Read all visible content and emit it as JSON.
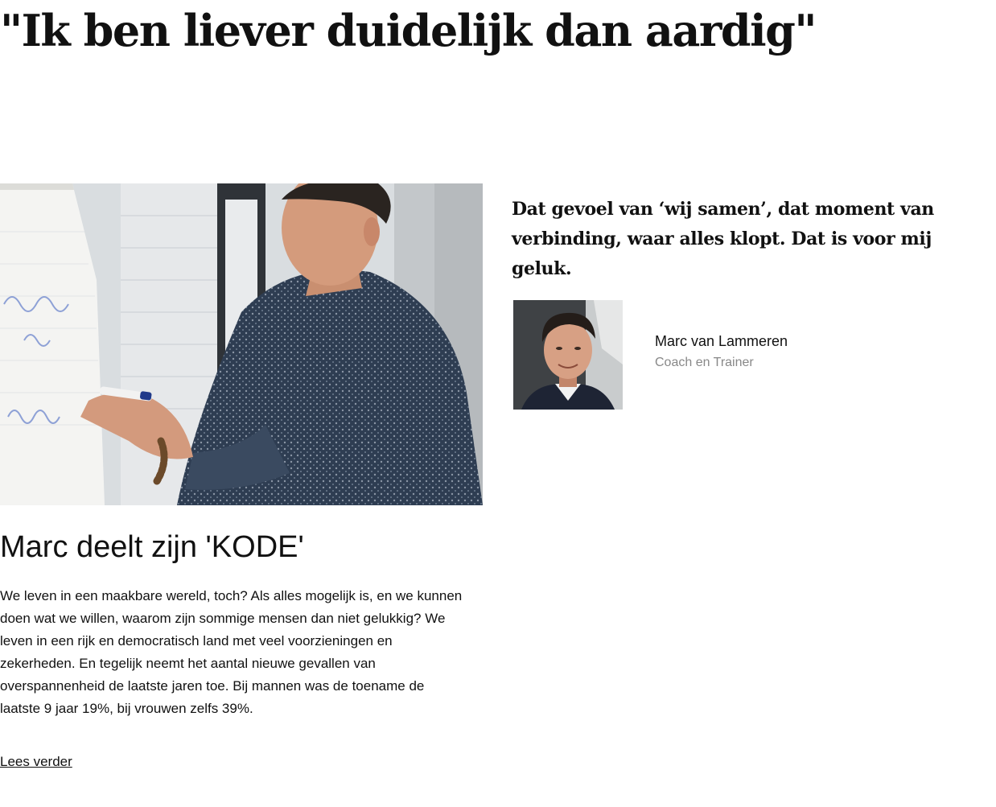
{
  "headline": "\"Ik ben liever duidelijk dan aardig\"",
  "hero": {
    "image_name": "trainer-writing-on-flipchart"
  },
  "quote": "Dat gevoel van ‘wij samen’, dat moment van verbinding, waar alles klopt. Dat is voor mij geluk.",
  "author": {
    "name": "Marc van Lammeren",
    "role": "Coach en Trainer"
  },
  "article": {
    "title": "Marc deelt zijn 'KODE'",
    "body": "We leven in een maakbare wereld, toch? Als alles mogelijk is, en we kunnen doen wat we willen, waarom zijn sommige mensen dan niet gelukkig? We leven in een rijk en democratisch land met veel voorzieningen en zekerheden. En tegelijk neemt het aantal nieuwe gevallen van overspannenheid de laatste jaren toe. Bij mannen was de toename de laatste 9 jaar 19%, bij vrouwen zelfs 39%.",
    "read_more": "Lees verder"
  },
  "colors": {
    "text": "#111111",
    "muted": "#888888",
    "background": "#ffffff"
  }
}
